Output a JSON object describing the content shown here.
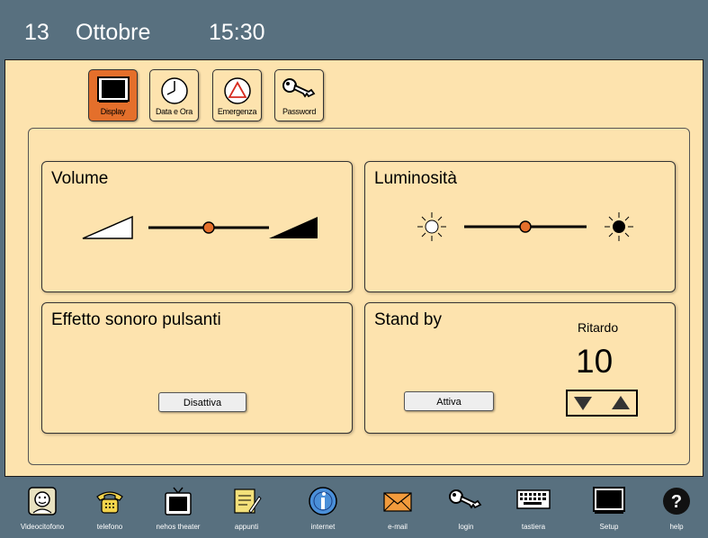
{
  "header": {
    "day": "13",
    "month": "Ottobre",
    "time": "15:30"
  },
  "tabs": [
    {
      "label": "Display",
      "active": true,
      "icon": "monitor-icon"
    },
    {
      "label": "Data e Ora",
      "active": false,
      "icon": "clock-icon"
    },
    {
      "label": "Emergenza",
      "active": false,
      "icon": "warning-triangle-icon"
    },
    {
      "label": "Password",
      "active": false,
      "icon": "key-icon"
    }
  ],
  "volume": {
    "title": "Volume",
    "level": 0.5
  },
  "brightness": {
    "title": "Luminosità",
    "level": 0.5
  },
  "sound": {
    "title": "Effetto sonoro pulsanti",
    "button_label": "Disattiva"
  },
  "standby": {
    "title": "Stand by",
    "button_label": "Attiva",
    "delay_label": "Ritardo",
    "delay_value": "10"
  },
  "dock": [
    {
      "label": "Videocitofono",
      "icon": "face-icon"
    },
    {
      "label": "telefono",
      "icon": "phone-icon"
    },
    {
      "label": "nehos theater",
      "icon": "tv-icon"
    },
    {
      "label": "appunti",
      "icon": "notepad-icon"
    },
    {
      "label": "internet",
      "icon": "info-icon"
    },
    {
      "label": "e-mail",
      "icon": "envelope-icon"
    },
    {
      "label": "login",
      "icon": "key-icon"
    },
    {
      "label": "tastiera",
      "icon": "keyboard-icon"
    },
    {
      "label": "Setup",
      "icon": "monitor-icon"
    },
    {
      "label": "help",
      "icon": "help-icon"
    }
  ],
  "colors": {
    "accent": "#e46f2b",
    "panel": "#fde3ae",
    "chrome": "#58707f"
  }
}
